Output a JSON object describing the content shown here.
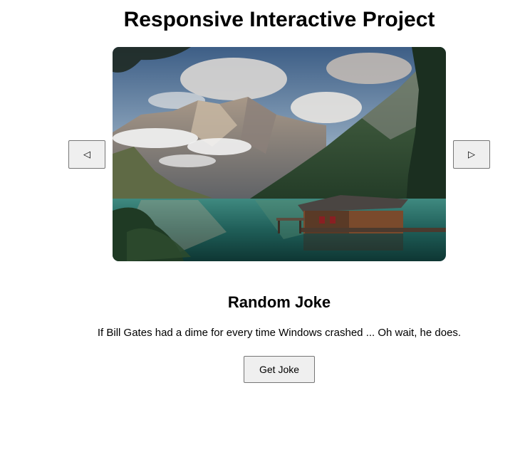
{
  "header": {
    "title": "Responsive Interactive Project"
  },
  "carousel": {
    "prev_icon": "triangle-left-icon",
    "prev_glyph": "◁",
    "next_icon": "triangle-right-icon",
    "next_glyph": "▷",
    "image_subject": "mountain-lake-with-boathouse"
  },
  "joke": {
    "heading": "Random Joke",
    "text": "If Bill Gates had a dime for every time Windows crashed ... Oh wait, he does.",
    "button_label": "Get Joke"
  }
}
